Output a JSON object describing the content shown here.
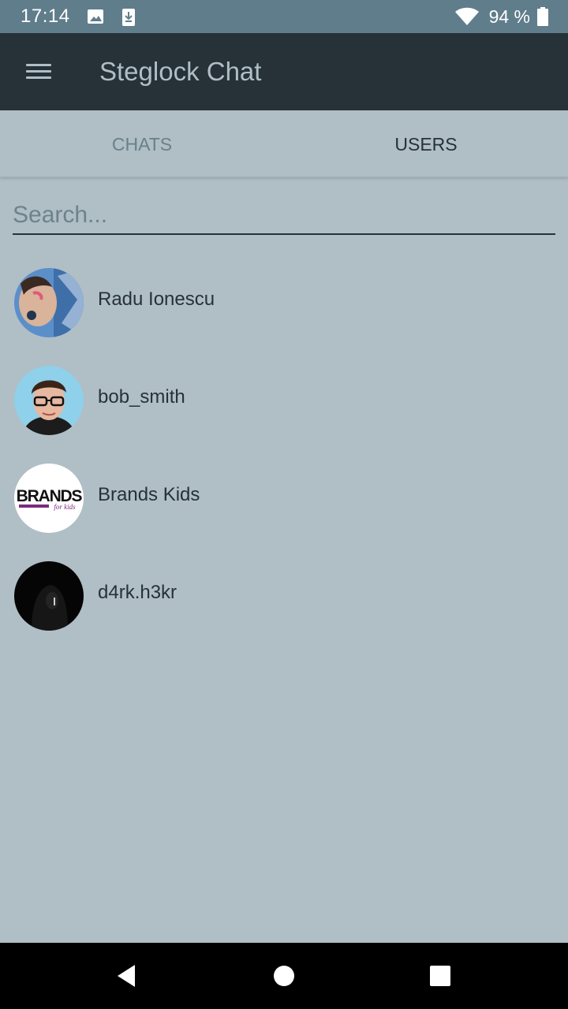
{
  "status_bar": {
    "time": "17:14",
    "battery": "94 %",
    "icons": [
      "image-icon",
      "download-icon",
      "wifi-icon",
      "battery-icon"
    ]
  },
  "app_bar": {
    "title": "Steglock Chat",
    "menu_icon": "menu-icon"
  },
  "tabs": [
    {
      "label": "CHATS",
      "selected": false
    },
    {
      "label": "USERS",
      "selected": true
    }
  ],
  "search": {
    "placeholder": "Search...",
    "value": ""
  },
  "users": [
    {
      "name": "Radu Ionescu"
    },
    {
      "name": "bob_smith"
    },
    {
      "name": "Brands Kids",
      "avatar_text": "BRANDS",
      "avatar_subtext": "for kids"
    },
    {
      "name": "d4rk.h3kr"
    }
  ],
  "nav_bar": {
    "icons": [
      "back-icon",
      "home-icon",
      "recents-icon"
    ]
  },
  "colors": {
    "status_bar": "#607d8b",
    "app_bar": "#263238",
    "background": "#b0bec5",
    "text_primary": "#263238",
    "tab_inactive": "#6a808b"
  }
}
